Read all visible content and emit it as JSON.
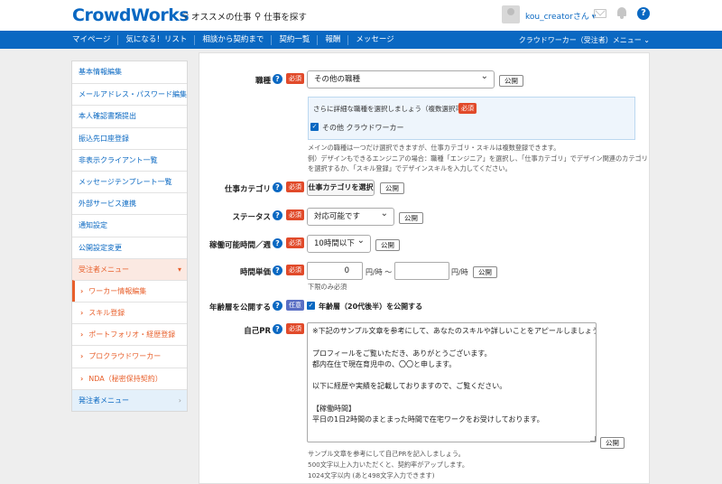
{
  "header": {
    "logo": "CrowdWorks",
    "nav_recommend": "オススメの仕事",
    "nav_search": "仕事を探す",
    "username": "kou_creatorさん",
    "help": "?"
  },
  "bluebar": {
    "items": [
      "マイページ",
      "気になる！リスト",
      "相談から契約まで",
      "契約一覧",
      "報酬",
      "メッセージ"
    ],
    "right_menu": "クラウドワーカー（受注者）メニュー"
  },
  "sidebar": {
    "items": [
      "基本情報編集",
      "メールアドレス・パスワード編集",
      "本人確認書類提出",
      "振込先口座登録",
      "非表示クライアント一覧",
      "メッセージテンプレート一覧",
      "外部サービス連携",
      "通知設定",
      "公開設定変更",
      "受注者メニュー",
      "ワーカー情報編集",
      "スキル登録",
      "ポートフォリオ・経歴登録",
      "プロクラウドワーカー",
      "NDA（秘密保持契約）",
      "発注者メニュー"
    ]
  },
  "form": {
    "required": "必須",
    "optional": "任意",
    "public": "公開",
    "occupation": {
      "label": "職種",
      "value": "その他の職種",
      "detail_title": "さらに詳細な職種を選択しましょう（複数選択可）",
      "detail_option": "その他 クラウドワーカー",
      "note1": "メインの職種は一つだけ選択できますが、仕事カテゴリ・スキルは複数登録できます。",
      "note2": "例）デザインもできるエンジニアの場合：職種「エンジニア」を選択し、「仕事カテゴリ」でデザイン関連のカテゴリ",
      "note3": "を選択するか、「スキル登録」でデザインスキルを入力してください。"
    },
    "category": {
      "label": "仕事カテゴリ",
      "button": "仕事カテゴリを選択"
    },
    "status": {
      "label": "ステータス",
      "value": "対応可能です"
    },
    "hours": {
      "label": "稼働可能時間／週",
      "value": "10時間以下"
    },
    "rate": {
      "label": "時間単価",
      "min_value": "0",
      "unit1": "円/時 〜",
      "unit2": "円/時",
      "note": "下限のみ必須"
    },
    "age": {
      "label": "年齢層を公開する",
      "option": "年齢層（20代後半）を公開する"
    },
    "pr": {
      "label": "自己PR",
      "lines": [
        "※下記のサンプル文章を参考にして、あなたのスキルや詳しいことをアピールしましょう。",
        "",
        "プロフィールをご覧いただき、ありがとうございます。",
        "都内在住で現在育児中の、〇〇と申します。",
        "",
        "以下に経歴や実績を記載しておりますので、ご覧ください。",
        "",
        "【稼働時間】",
        "平日の1日2時間のまとまった時間で在宅ワークをお受けしております。"
      ],
      "note1": "サンプル文章を参考にして自己PRを記入しましょう。",
      "note2": "500文字以上入力いただくと、契約率がアップします。",
      "note3": "1024文字以内 (あと498文字入力できます)"
    }
  }
}
